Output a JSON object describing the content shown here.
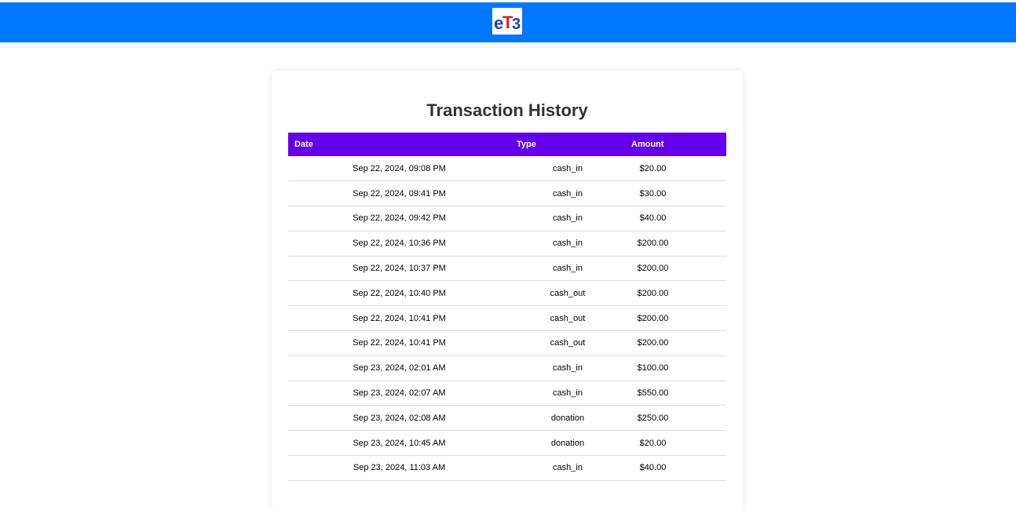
{
  "brand": {
    "header_color": "#0078ff",
    "accent_color": "#6200ea",
    "logo_text": "eT3"
  },
  "page": {
    "title": "Transaction History"
  },
  "table": {
    "headers": {
      "date": "Date",
      "type": "Type",
      "amount": "Amount"
    },
    "rows": [
      {
        "date": "Sep 22, 2024, 09:08 PM",
        "type": "cash_in",
        "amount": "$20.00"
      },
      {
        "date": "Sep 22, 2024, 09:41 PM",
        "type": "cash_in",
        "amount": "$30.00"
      },
      {
        "date": "Sep 22, 2024, 09:42 PM",
        "type": "cash_in",
        "amount": "$40.00"
      },
      {
        "date": "Sep 22, 2024, 10:36 PM",
        "type": "cash_in",
        "amount": "$200.00"
      },
      {
        "date": "Sep 22, 2024, 10:37 PM",
        "type": "cash_in",
        "amount": "$200.00"
      },
      {
        "date": "Sep 22, 2024, 10:40 PM",
        "type": "cash_out",
        "amount": "$200.00"
      },
      {
        "date": "Sep 22, 2024, 10:41 PM",
        "type": "cash_out",
        "amount": "$200.00"
      },
      {
        "date": "Sep 22, 2024, 10:41 PM",
        "type": "cash_out",
        "amount": "$200.00"
      },
      {
        "date": "Sep 23, 2024, 02:01 AM",
        "type": "cash_in",
        "amount": "$100.00"
      },
      {
        "date": "Sep 23, 2024, 02:07 AM",
        "type": "cash_in",
        "amount": "$550.00"
      },
      {
        "date": "Sep 23, 2024, 02:08 AM",
        "type": "donation",
        "amount": "$250.00"
      },
      {
        "date": "Sep 23, 2024, 10:45 AM",
        "type": "donation",
        "amount": "$20.00"
      },
      {
        "date": "Sep 23, 2024, 11:03 AM",
        "type": "cash_in",
        "amount": "$40.00"
      }
    ]
  }
}
